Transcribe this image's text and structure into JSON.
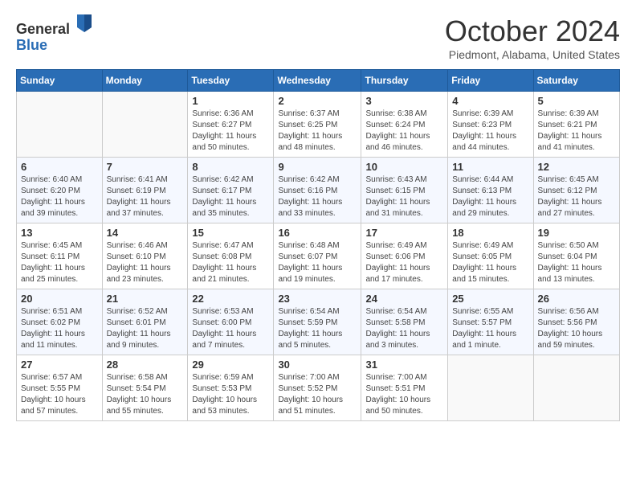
{
  "header": {
    "logo_general": "General",
    "logo_blue": "Blue",
    "title": "October 2024",
    "location": "Piedmont, Alabama, United States"
  },
  "days_of_week": [
    "Sunday",
    "Monday",
    "Tuesday",
    "Wednesday",
    "Thursday",
    "Friday",
    "Saturday"
  ],
  "weeks": [
    [
      {
        "day": "",
        "info": ""
      },
      {
        "day": "",
        "info": ""
      },
      {
        "day": "1",
        "info": "Sunrise: 6:36 AM\nSunset: 6:27 PM\nDaylight: 11 hours and 50 minutes."
      },
      {
        "day": "2",
        "info": "Sunrise: 6:37 AM\nSunset: 6:25 PM\nDaylight: 11 hours and 48 minutes."
      },
      {
        "day": "3",
        "info": "Sunrise: 6:38 AM\nSunset: 6:24 PM\nDaylight: 11 hours and 46 minutes."
      },
      {
        "day": "4",
        "info": "Sunrise: 6:39 AM\nSunset: 6:23 PM\nDaylight: 11 hours and 44 minutes."
      },
      {
        "day": "5",
        "info": "Sunrise: 6:39 AM\nSunset: 6:21 PM\nDaylight: 11 hours and 41 minutes."
      }
    ],
    [
      {
        "day": "6",
        "info": "Sunrise: 6:40 AM\nSunset: 6:20 PM\nDaylight: 11 hours and 39 minutes."
      },
      {
        "day": "7",
        "info": "Sunrise: 6:41 AM\nSunset: 6:19 PM\nDaylight: 11 hours and 37 minutes."
      },
      {
        "day": "8",
        "info": "Sunrise: 6:42 AM\nSunset: 6:17 PM\nDaylight: 11 hours and 35 minutes."
      },
      {
        "day": "9",
        "info": "Sunrise: 6:42 AM\nSunset: 6:16 PM\nDaylight: 11 hours and 33 minutes."
      },
      {
        "day": "10",
        "info": "Sunrise: 6:43 AM\nSunset: 6:15 PM\nDaylight: 11 hours and 31 minutes."
      },
      {
        "day": "11",
        "info": "Sunrise: 6:44 AM\nSunset: 6:13 PM\nDaylight: 11 hours and 29 minutes."
      },
      {
        "day": "12",
        "info": "Sunrise: 6:45 AM\nSunset: 6:12 PM\nDaylight: 11 hours and 27 minutes."
      }
    ],
    [
      {
        "day": "13",
        "info": "Sunrise: 6:45 AM\nSunset: 6:11 PM\nDaylight: 11 hours and 25 minutes."
      },
      {
        "day": "14",
        "info": "Sunrise: 6:46 AM\nSunset: 6:10 PM\nDaylight: 11 hours and 23 minutes."
      },
      {
        "day": "15",
        "info": "Sunrise: 6:47 AM\nSunset: 6:08 PM\nDaylight: 11 hours and 21 minutes."
      },
      {
        "day": "16",
        "info": "Sunrise: 6:48 AM\nSunset: 6:07 PM\nDaylight: 11 hours and 19 minutes."
      },
      {
        "day": "17",
        "info": "Sunrise: 6:49 AM\nSunset: 6:06 PM\nDaylight: 11 hours and 17 minutes."
      },
      {
        "day": "18",
        "info": "Sunrise: 6:49 AM\nSunset: 6:05 PM\nDaylight: 11 hours and 15 minutes."
      },
      {
        "day": "19",
        "info": "Sunrise: 6:50 AM\nSunset: 6:04 PM\nDaylight: 11 hours and 13 minutes."
      }
    ],
    [
      {
        "day": "20",
        "info": "Sunrise: 6:51 AM\nSunset: 6:02 PM\nDaylight: 11 hours and 11 minutes."
      },
      {
        "day": "21",
        "info": "Sunrise: 6:52 AM\nSunset: 6:01 PM\nDaylight: 11 hours and 9 minutes."
      },
      {
        "day": "22",
        "info": "Sunrise: 6:53 AM\nSunset: 6:00 PM\nDaylight: 11 hours and 7 minutes."
      },
      {
        "day": "23",
        "info": "Sunrise: 6:54 AM\nSunset: 5:59 PM\nDaylight: 11 hours and 5 minutes."
      },
      {
        "day": "24",
        "info": "Sunrise: 6:54 AM\nSunset: 5:58 PM\nDaylight: 11 hours and 3 minutes."
      },
      {
        "day": "25",
        "info": "Sunrise: 6:55 AM\nSunset: 5:57 PM\nDaylight: 11 hours and 1 minute."
      },
      {
        "day": "26",
        "info": "Sunrise: 6:56 AM\nSunset: 5:56 PM\nDaylight: 10 hours and 59 minutes."
      }
    ],
    [
      {
        "day": "27",
        "info": "Sunrise: 6:57 AM\nSunset: 5:55 PM\nDaylight: 10 hours and 57 minutes."
      },
      {
        "day": "28",
        "info": "Sunrise: 6:58 AM\nSunset: 5:54 PM\nDaylight: 10 hours and 55 minutes."
      },
      {
        "day": "29",
        "info": "Sunrise: 6:59 AM\nSunset: 5:53 PM\nDaylight: 10 hours and 53 minutes."
      },
      {
        "day": "30",
        "info": "Sunrise: 7:00 AM\nSunset: 5:52 PM\nDaylight: 10 hours and 51 minutes."
      },
      {
        "day": "31",
        "info": "Sunrise: 7:00 AM\nSunset: 5:51 PM\nDaylight: 10 hours and 50 minutes."
      },
      {
        "day": "",
        "info": ""
      },
      {
        "day": "",
        "info": ""
      }
    ]
  ]
}
